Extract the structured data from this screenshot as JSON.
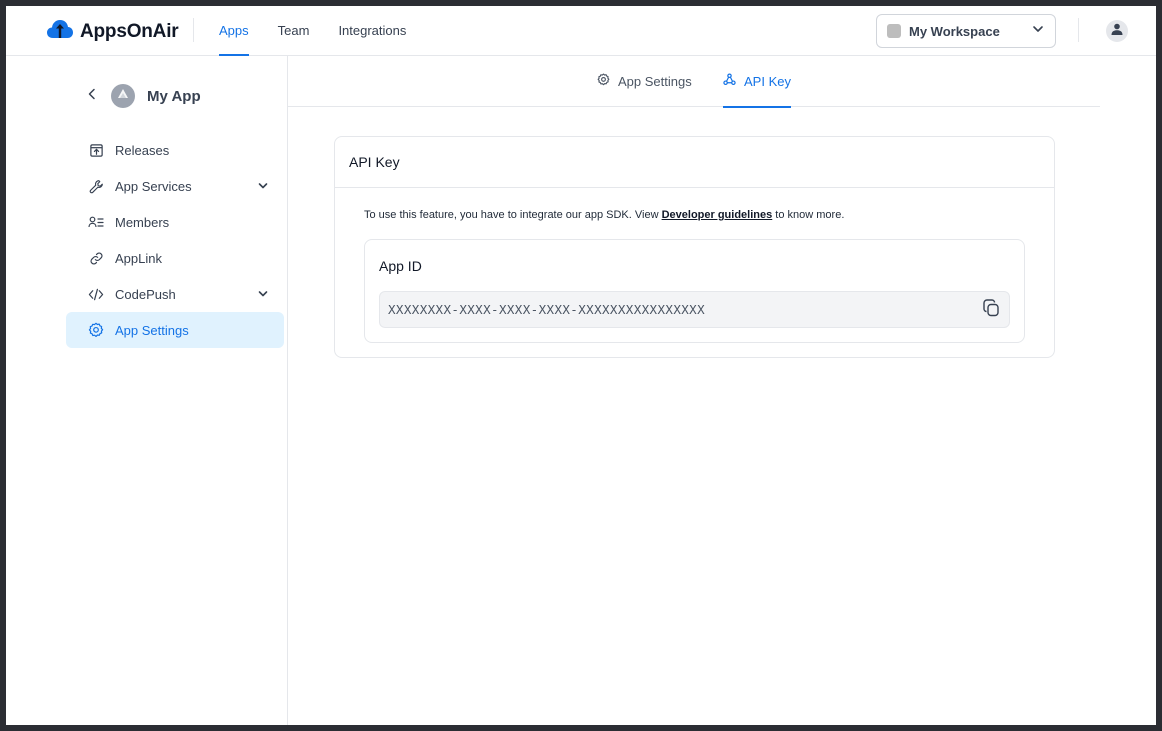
{
  "brand": {
    "name": "AppsOnAir",
    "accent": "#1473e6"
  },
  "topnav": {
    "items": [
      {
        "label": "Apps",
        "active": true
      },
      {
        "label": "Team",
        "active": false
      },
      {
        "label": "Integrations",
        "active": false
      }
    ]
  },
  "workspace": {
    "label": "My Workspace"
  },
  "sidebar": {
    "app_name": "My App",
    "items": [
      {
        "label": "Releases",
        "icon": "upload-box-icon"
      },
      {
        "label": "App Services",
        "icon": "wrench-icon",
        "expandable": true
      },
      {
        "label": "Members",
        "icon": "members-icon"
      },
      {
        "label": "AppLink",
        "icon": "link-icon"
      },
      {
        "label": "CodePush",
        "icon": "code-icon",
        "expandable": true
      },
      {
        "label": "App Settings",
        "icon": "gear-icon",
        "active": true
      }
    ]
  },
  "tabs": [
    {
      "label": "App Settings",
      "icon": "gear-icon",
      "active": false
    },
    {
      "label": "API Key",
      "icon": "key-icon",
      "active": true
    }
  ],
  "api_card": {
    "title": "API Key",
    "desc_prefix": "To use this feature, you have to integrate our app SDK. View ",
    "desc_link": "Developer guidelines",
    "desc_suffix": " to know more.",
    "field_title": "App ID",
    "field_value": "XXXXXXXX-XXXX-XXXX-XXXX-XXXXXXXXXXXXXXXX"
  }
}
